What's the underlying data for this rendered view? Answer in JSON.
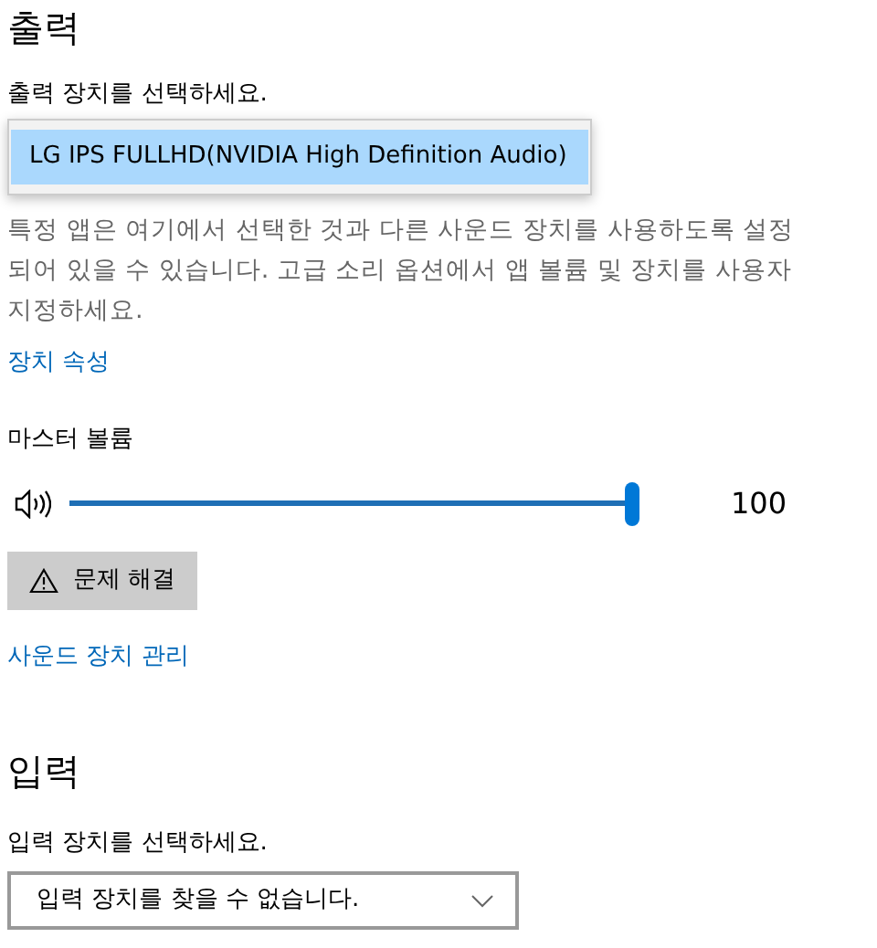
{
  "output": {
    "heading": "출력",
    "prompt": "출력 장치를 선택하세요.",
    "device_menu": [
      {
        "label": "LG IPS FULLHD(NVIDIA High Definition Audio)",
        "selected": true
      }
    ],
    "description": "특정 앱은 여기에서 선택한 것과 다른 사운드 장치를 사용하도록 설정되어 있을 수 있습니다. 고급 소리 옵션에서 앱 볼륨 및 장치를 사용자 지정하세요.",
    "properties_link": "장치 속성",
    "volume": {
      "label": "마스터 볼륨",
      "level": 1,
      "reading": "100"
    },
    "troubleshoot_button": "문제 해결",
    "manage_link": "사운드 장치 관리"
  },
  "input": {
    "heading": "입력",
    "prompt": "입력 장치를 선택하세요.",
    "device_dropdown": {
      "value": "입력 장치를 찾을 수 없습니다."
    }
  }
}
